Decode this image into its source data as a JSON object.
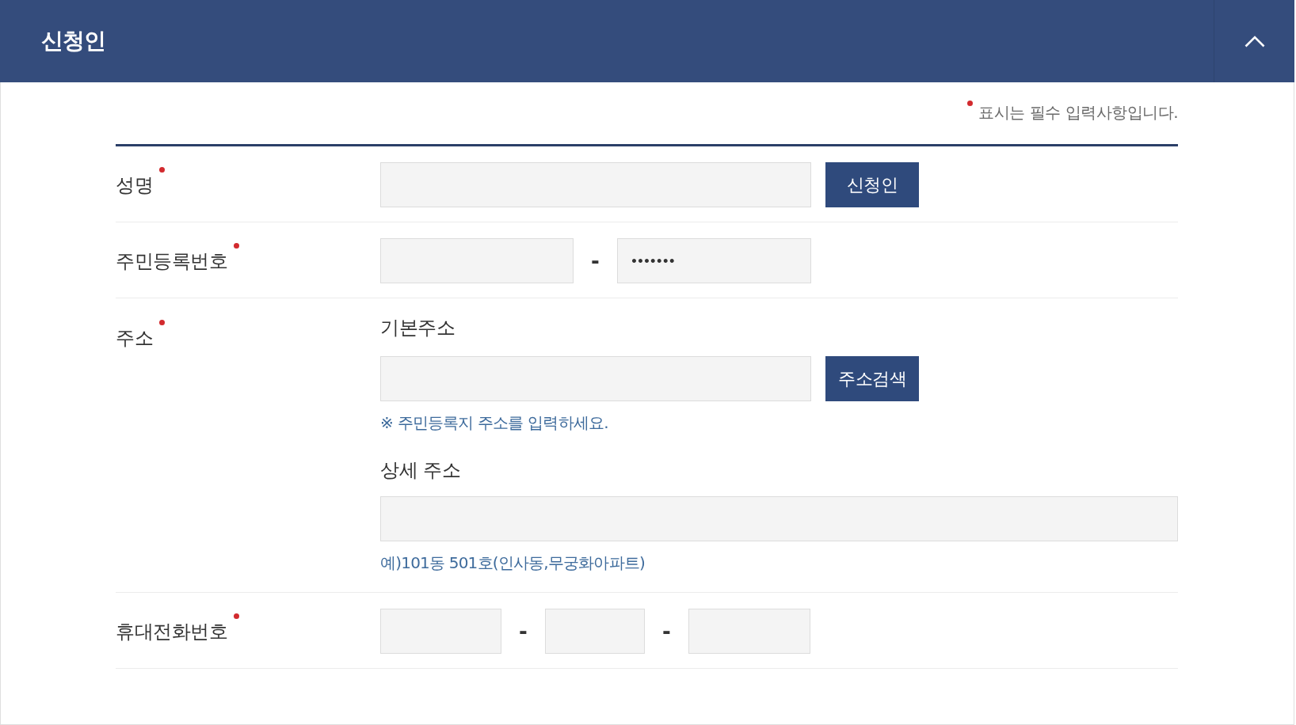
{
  "section": {
    "title": "신청인",
    "expanded": true
  },
  "required_note": "표시는 필수 입력사항입니다.",
  "rows": [
    {
      "kind": "name",
      "label": "성명",
      "required": true,
      "button": "신청인"
    },
    {
      "kind": "resident_number",
      "label": "주민등록번호",
      "required": true,
      "separator": "-",
      "back_value": "•••••••"
    },
    {
      "kind": "address",
      "label": "주소",
      "required": true,
      "basic_address": {
        "label": "기본주소",
        "button": "주소검색",
        "hint": "※ 주민등록지 주소를 입력하세요."
      },
      "detail_address": {
        "label": "상세 주소",
        "hint": "예)101동 501호(인사동,무궁화아파트)"
      }
    },
    {
      "kind": "phone",
      "label": "휴대전화번호",
      "required": true,
      "separators": [
        "-",
        "-"
      ]
    }
  ]
}
